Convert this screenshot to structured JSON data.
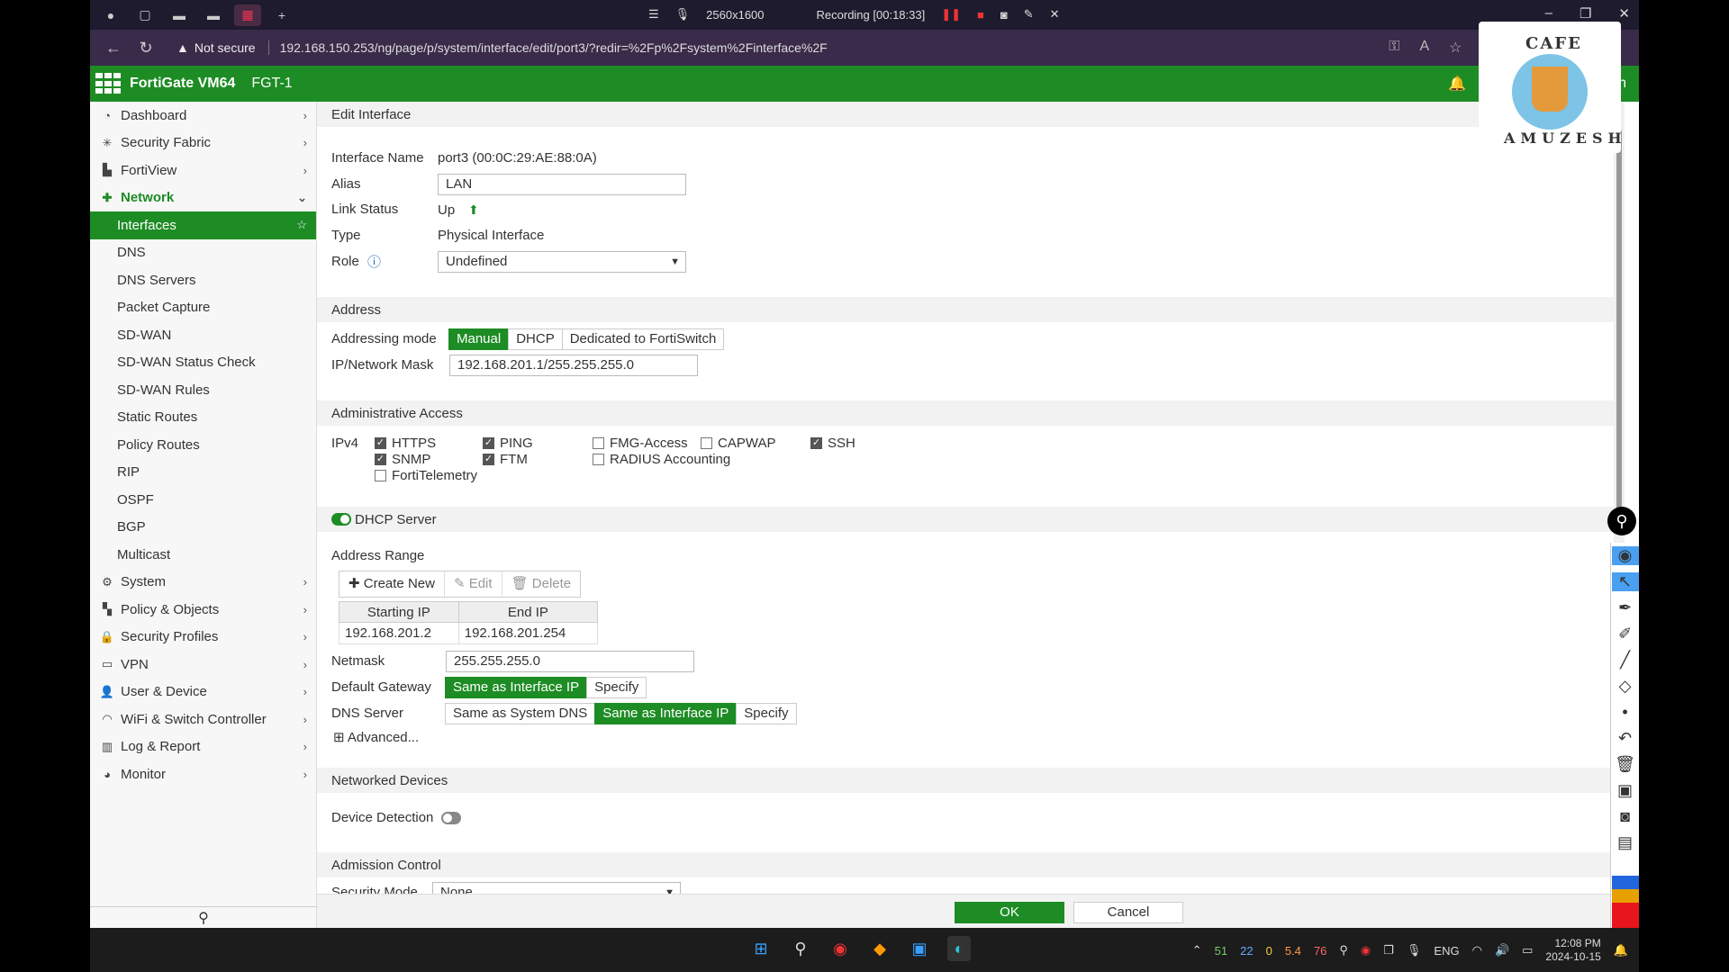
{
  "browser": {
    "recording_resolution": "2560x1600",
    "recording_label": "Recording [00:18:33]",
    "not_secure": "Not secure",
    "url": "192.168.150.253/ng/page/p/system/interface/edit/port3/?redir=%2Fp%2Fsystem%2Finterface%2F"
  },
  "app": {
    "title": "FortiGate VM64",
    "hostname": "FGT-1",
    "user": "admin"
  },
  "sidebar": {
    "items": [
      {
        "label": "Dashboard",
        "icon": "dashboard-icon"
      },
      {
        "label": "Security Fabric",
        "icon": "fabric-icon"
      },
      {
        "label": "FortiView",
        "icon": "chart-icon"
      },
      {
        "label": "Network",
        "icon": "network-icon"
      }
    ],
    "network_sub": [
      "Interfaces",
      "DNS",
      "DNS Servers",
      "Packet Capture",
      "SD-WAN",
      "SD-WAN Status Check",
      "SD-WAN Rules",
      "Static Routes",
      "Policy Routes",
      "RIP",
      "OSPF",
      "BGP",
      "Multicast"
    ],
    "items_after": [
      {
        "label": "System",
        "icon": "gear-icon"
      },
      {
        "label": "Policy & Objects",
        "icon": "policy-icon"
      },
      {
        "label": "Security Profiles",
        "icon": "lock-icon"
      },
      {
        "label": "VPN",
        "icon": "laptop-icon"
      },
      {
        "label": "User & Device",
        "icon": "user-icon"
      },
      {
        "label": "WiFi & Switch Controller",
        "icon": "wifi-icon"
      },
      {
        "label": "Log & Report",
        "icon": "bar-chart-icon"
      },
      {
        "label": "Monitor",
        "icon": "pie-chart-icon"
      }
    ]
  },
  "form": {
    "page_title": "Edit Interface",
    "interface_name_label": "Interface Name",
    "interface_name_value": "port3 (00:0C:29:AE:88:0A)",
    "alias_label": "Alias",
    "alias_value": "LAN",
    "link_status_label": "Link Status",
    "link_status_value": "Up",
    "type_label": "Type",
    "type_value": "Physical Interface",
    "role_label": "Role",
    "role_value": "Undefined",
    "address_head": "Address",
    "addressing_mode_label": "Addressing mode",
    "addressing_modes": [
      "Manual",
      "DHCP",
      "Dedicated to FortiSwitch"
    ],
    "ipmask_label": "IP/Network Mask",
    "ipmask_value": "192.168.201.1/255.255.255.0",
    "admin_access_head": "Administrative Access",
    "ipv4_label": "IPv4",
    "access": {
      "https": "HTTPS",
      "ping": "PING",
      "fmg": "FMG-Access",
      "capwap": "CAPWAP",
      "ssh": "SSH",
      "snmp": "SNMP",
      "ftm": "FTM",
      "radius": "RADIUS Accounting",
      "fortitelemetry": "FortiTelemetry"
    },
    "dhcp_head": "DHCP Server",
    "address_range_label": "Address Range",
    "toolbar": {
      "create": "Create New",
      "edit": "Edit",
      "delete": "Delete"
    },
    "range_headers": [
      "Starting IP",
      "End IP"
    ],
    "range_rows": [
      [
        "192.168.201.2",
        "192.168.201.254"
      ]
    ],
    "netmask_label": "Netmask",
    "netmask_value": "255.255.255.0",
    "gateway_label": "Default Gateway",
    "gateway_options": [
      "Same as Interface IP",
      "Specify"
    ],
    "dns_label": "DNS Server",
    "dns_options": [
      "Same as System DNS",
      "Same as Interface IP",
      "Specify"
    ],
    "advanced": "Advanced...",
    "networked_head": "Networked Devices",
    "device_detection_label": "Device Detection",
    "admission_head": "Admission Control",
    "security_mode_label": "Security Mode",
    "security_mode_value": "None"
  },
  "footer": {
    "ok": "OK",
    "cancel": "Cancel"
  },
  "logo": {
    "top": "CAFE",
    "bottom": "AMUZESH"
  },
  "taskbar": {
    "stats": [
      "51",
      "22",
      "0",
      "5.4",
      "76"
    ],
    "lang": "ENG",
    "time": "12:08 PM",
    "date": "2024-10-15"
  },
  "colors": {
    "brand_green": "#1d8c24"
  }
}
